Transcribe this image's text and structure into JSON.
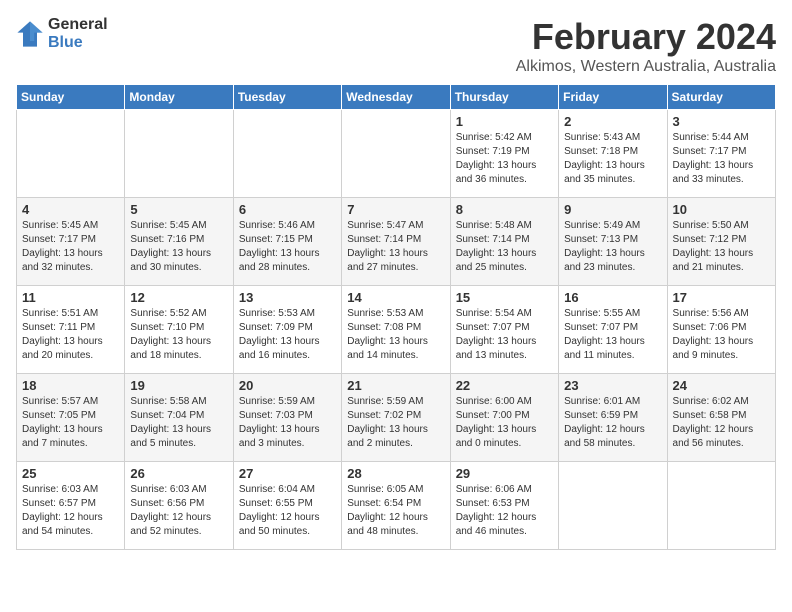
{
  "logo": {
    "general": "General",
    "blue": "Blue"
  },
  "title": {
    "month_year": "February 2024",
    "location": "Alkimos, Western Australia, Australia"
  },
  "calendar": {
    "headers": [
      "Sunday",
      "Monday",
      "Tuesday",
      "Wednesday",
      "Thursday",
      "Friday",
      "Saturday"
    ],
    "weeks": [
      [
        {
          "day": "",
          "info": ""
        },
        {
          "day": "",
          "info": ""
        },
        {
          "day": "",
          "info": ""
        },
        {
          "day": "",
          "info": ""
        },
        {
          "day": "1",
          "info": "Sunrise: 5:42 AM\nSunset: 7:19 PM\nDaylight: 13 hours\nand 36 minutes."
        },
        {
          "day": "2",
          "info": "Sunrise: 5:43 AM\nSunset: 7:18 PM\nDaylight: 13 hours\nand 35 minutes."
        },
        {
          "day": "3",
          "info": "Sunrise: 5:44 AM\nSunset: 7:17 PM\nDaylight: 13 hours\nand 33 minutes."
        }
      ],
      [
        {
          "day": "4",
          "info": "Sunrise: 5:45 AM\nSunset: 7:17 PM\nDaylight: 13 hours\nand 32 minutes."
        },
        {
          "day": "5",
          "info": "Sunrise: 5:45 AM\nSunset: 7:16 PM\nDaylight: 13 hours\nand 30 minutes."
        },
        {
          "day": "6",
          "info": "Sunrise: 5:46 AM\nSunset: 7:15 PM\nDaylight: 13 hours\nand 28 minutes."
        },
        {
          "day": "7",
          "info": "Sunrise: 5:47 AM\nSunset: 7:14 PM\nDaylight: 13 hours\nand 27 minutes."
        },
        {
          "day": "8",
          "info": "Sunrise: 5:48 AM\nSunset: 7:14 PM\nDaylight: 13 hours\nand 25 minutes."
        },
        {
          "day": "9",
          "info": "Sunrise: 5:49 AM\nSunset: 7:13 PM\nDaylight: 13 hours\nand 23 minutes."
        },
        {
          "day": "10",
          "info": "Sunrise: 5:50 AM\nSunset: 7:12 PM\nDaylight: 13 hours\nand 21 minutes."
        }
      ],
      [
        {
          "day": "11",
          "info": "Sunrise: 5:51 AM\nSunset: 7:11 PM\nDaylight: 13 hours\nand 20 minutes."
        },
        {
          "day": "12",
          "info": "Sunrise: 5:52 AM\nSunset: 7:10 PM\nDaylight: 13 hours\nand 18 minutes."
        },
        {
          "day": "13",
          "info": "Sunrise: 5:53 AM\nSunset: 7:09 PM\nDaylight: 13 hours\nand 16 minutes."
        },
        {
          "day": "14",
          "info": "Sunrise: 5:53 AM\nSunset: 7:08 PM\nDaylight: 13 hours\nand 14 minutes."
        },
        {
          "day": "15",
          "info": "Sunrise: 5:54 AM\nSunset: 7:07 PM\nDaylight: 13 hours\nand 13 minutes."
        },
        {
          "day": "16",
          "info": "Sunrise: 5:55 AM\nSunset: 7:07 PM\nDaylight: 13 hours\nand 11 minutes."
        },
        {
          "day": "17",
          "info": "Sunrise: 5:56 AM\nSunset: 7:06 PM\nDaylight: 13 hours\nand 9 minutes."
        }
      ],
      [
        {
          "day": "18",
          "info": "Sunrise: 5:57 AM\nSunset: 7:05 PM\nDaylight: 13 hours\nand 7 minutes."
        },
        {
          "day": "19",
          "info": "Sunrise: 5:58 AM\nSunset: 7:04 PM\nDaylight: 13 hours\nand 5 minutes."
        },
        {
          "day": "20",
          "info": "Sunrise: 5:59 AM\nSunset: 7:03 PM\nDaylight: 13 hours\nand 3 minutes."
        },
        {
          "day": "21",
          "info": "Sunrise: 5:59 AM\nSunset: 7:02 PM\nDaylight: 13 hours\nand 2 minutes."
        },
        {
          "day": "22",
          "info": "Sunrise: 6:00 AM\nSunset: 7:00 PM\nDaylight: 13 hours\nand 0 minutes."
        },
        {
          "day": "23",
          "info": "Sunrise: 6:01 AM\nSunset: 6:59 PM\nDaylight: 12 hours\nand 58 minutes."
        },
        {
          "day": "24",
          "info": "Sunrise: 6:02 AM\nSunset: 6:58 PM\nDaylight: 12 hours\nand 56 minutes."
        }
      ],
      [
        {
          "day": "25",
          "info": "Sunrise: 6:03 AM\nSunset: 6:57 PM\nDaylight: 12 hours\nand 54 minutes."
        },
        {
          "day": "26",
          "info": "Sunrise: 6:03 AM\nSunset: 6:56 PM\nDaylight: 12 hours\nand 52 minutes."
        },
        {
          "day": "27",
          "info": "Sunrise: 6:04 AM\nSunset: 6:55 PM\nDaylight: 12 hours\nand 50 minutes."
        },
        {
          "day": "28",
          "info": "Sunrise: 6:05 AM\nSunset: 6:54 PM\nDaylight: 12 hours\nand 48 minutes."
        },
        {
          "day": "29",
          "info": "Sunrise: 6:06 AM\nSunset: 6:53 PM\nDaylight: 12 hours\nand 46 minutes."
        },
        {
          "day": "",
          "info": ""
        },
        {
          "day": "",
          "info": ""
        }
      ]
    ]
  }
}
